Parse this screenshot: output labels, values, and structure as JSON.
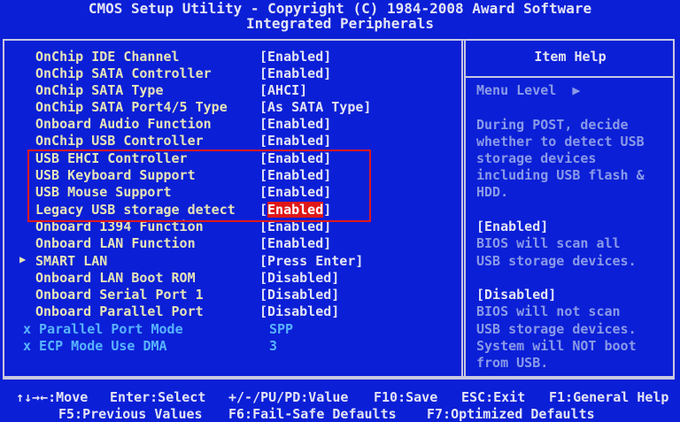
{
  "header": {
    "title": "CMOS Setup Utility - Copyright (C) 1984-2008 Award Software",
    "subtitle": "Integrated Peripherals"
  },
  "settings": [
    {
      "label": "OnChip IDE Channel",
      "value": "[Enabled]"
    },
    {
      "label": "OnChip SATA Controller",
      "value": "[Enabled]"
    },
    {
      "label": "OnChip SATA Type",
      "value": "[AHCI]"
    },
    {
      "label": "OnChip SATA Port4/5 Type",
      "value": "[As SATA Type]"
    },
    {
      "label": "Onboard Audio Function",
      "value": "[Enabled]"
    },
    {
      "label": "OnChip USB Controller",
      "value": "[Enabled]"
    },
    {
      "label": "USB EHCI Controller",
      "value": "[Enabled]"
    },
    {
      "label": "USB Keyboard Support",
      "value": "[Enabled]"
    },
    {
      "label": "USB Mouse Support",
      "value": "[Enabled]"
    },
    {
      "label": "Legacy USB storage detect",
      "value_open": "[",
      "value_selected": "Enabled",
      "value_close": "]"
    },
    {
      "label": "Onboard 1394 Function",
      "value": "[Enabled]"
    },
    {
      "label": "Onboard LAN Function",
      "value": "[Enabled]"
    },
    {
      "label": "SMART LAN",
      "value": "[Press Enter]",
      "submenu_marker": "▶"
    },
    {
      "label": "Onboard LAN Boot ROM",
      "value": "[Disabled]"
    },
    {
      "label": "Onboard Serial Port 1",
      "value": "[Disabled]"
    },
    {
      "label": "Onboard Parallel Port",
      "value": "[Disabled]"
    },
    {
      "label": "x Parallel Port Mode",
      "value": "SPP"
    },
    {
      "label": "x ECP Mode Use DMA",
      "value": "3"
    }
  ],
  "help": {
    "title": "Item Help",
    "menu_level": "Menu Level  ▶",
    "lines": [
      "During POST, decide",
      "whether to detect USB",
      "storage devices",
      "including USB flash &",
      "HDD.",
      "",
      "[Enabled]",
      "BIOS will scan all",
      "USB storage devices.",
      "",
      "[Disabled]",
      "BIOS will not scan",
      "USB storage devices.",
      "System will NOT boot",
      "from USB."
    ]
  },
  "footer": {
    "line1": [
      "↑↓→←:Move",
      "Enter:Select",
      "+/-/PU/PD:Value",
      "F10:Save",
      "ESC:Exit",
      "F1:General Help"
    ],
    "line2": [
      "F5:Previous Values",
      "F6:Fail-Safe Defaults",
      "F7:Optimized Defaults"
    ]
  },
  "colors": {
    "background": "#0b1fd6",
    "label": "#e6e4b8",
    "value": "#e4e4f4",
    "disabled": "#58b4ff",
    "selection": "#e01818"
  }
}
